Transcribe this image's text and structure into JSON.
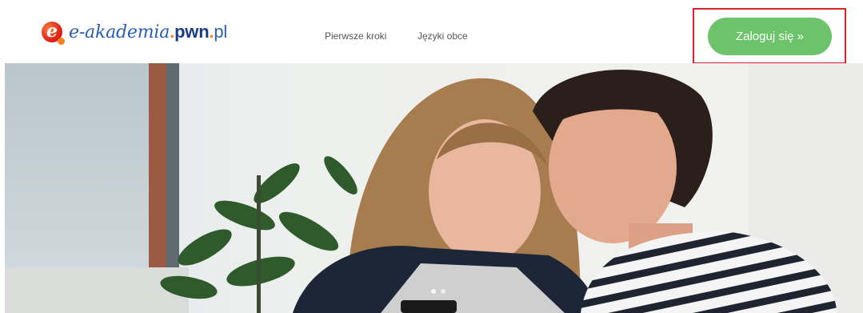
{
  "header": {
    "logo": {
      "icon": "e-icon",
      "text_ea": "e-akademia",
      "dot1": ".",
      "text_pwn": "pwn",
      "dot2": ".",
      "text_pl": "pl"
    },
    "nav": [
      {
        "label": "Pierwsze kroki"
      },
      {
        "label": "Języki obce"
      }
    ],
    "login_label": "Zaloguj się »"
  },
  "colors": {
    "login_button": "#6cc36a",
    "highlight_border": "#d8232a",
    "brand_blue": "#1a4fa0",
    "brand_orange": "#f58220"
  }
}
